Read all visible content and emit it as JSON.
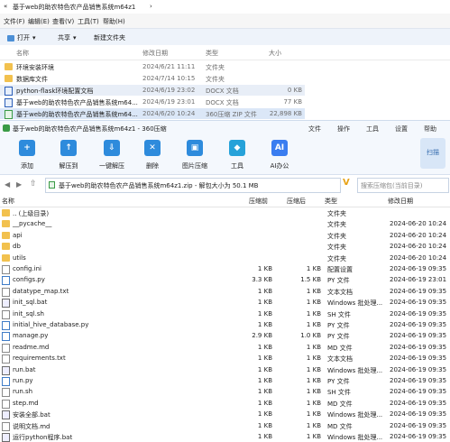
{
  "explorer": {
    "path": [
      "基于web的助农特色农产品销售系统m64z1"
    ],
    "menu": [
      "文件(F)",
      "编辑(E)",
      "查看(V)",
      "工具(T)",
      "帮助(H)"
    ],
    "toolbar": [
      "打开",
      "共享",
      "新建文件夹"
    ],
    "columns": {
      "name": "名称",
      "date": "修改日期",
      "type": "类型",
      "size": "大小"
    },
    "rows": [
      {
        "name": "环境安装环境",
        "date": "2024/6/21 11:11",
        "type": "文件夹",
        "size": "",
        "icon": "folder-icon"
      },
      {
        "name": "数据库文件",
        "date": "2024/7/14 10:15",
        "type": "文件夹",
        "size": "",
        "icon": "folder-icon"
      },
      {
        "name": "python-flask环境配置文档",
        "date": "2024/6/19 23:02",
        "type": "DOCX 文档",
        "size": "0 KB",
        "icon": "docx-icon"
      },
      {
        "name": "基于web的助农特色农产品销售系统m64...",
        "date": "2024/6/19 23:01",
        "type": "DOCX 文档",
        "size": "77 KB",
        "icon": "docx-icon"
      },
      {
        "name": "基于web的助农特色农产品销售系统m64...",
        "date": "2024/6/20 10:24",
        "type": "360压缩 ZIP 文件",
        "size": "22,898 KB",
        "icon": "zip-icon"
      }
    ]
  },
  "zip": {
    "title": "基于web的助农特色农产品销售系统m64z1 - 360压缩",
    "title_menu": [
      "文件",
      "操作",
      "工具",
      "设置",
      "帮助"
    ],
    "toolbar": [
      {
        "label": "添加",
        "icon": "add-icon",
        "color": "#2e8bdc"
      },
      {
        "label": "解压到",
        "icon": "extract-icon",
        "color": "#2e8bdc"
      },
      {
        "label": "一键解压",
        "icon": "one-click-extract-icon",
        "color": "#2e8bdc"
      },
      {
        "label": "删除",
        "icon": "delete-icon",
        "color": "#2e8bdc"
      },
      {
        "label": "图片压缩",
        "icon": "image-compress-icon",
        "color": "#2e8bdc"
      },
      {
        "label": "工具",
        "icon": "tools-icon",
        "color": "#26a2d9"
      },
      {
        "label": "AI办公",
        "icon": "ai-office-icon",
        "color": "#3a7df0"
      }
    ],
    "scan_label": "扫描",
    "address": "基于web的助农特色农产品销售系统m64z1.zip - 解包大小为 50.1 MB",
    "search_placeholder": "搜索压缩包(当前目录)",
    "columns": {
      "name": "名称",
      "size": "压缩前",
      "packed": "压缩后",
      "type": "类型",
      "date": "修改日期"
    },
    "rows": [
      {
        "name": ".. (上级目录)",
        "size": "",
        "packed": "",
        "type": "文件夹",
        "date": "",
        "icon": "folder"
      },
      {
        "name": "__pycache__",
        "size": "",
        "packed": "",
        "type": "文件夹",
        "date": "2024-06-20 10:24",
        "icon": "folder"
      },
      {
        "name": "api",
        "size": "",
        "packed": "",
        "type": "文件夹",
        "date": "2024-06-20 10:24",
        "icon": "folder"
      },
      {
        "name": "db",
        "size": "",
        "packed": "",
        "type": "文件夹",
        "date": "2024-06-20 10:24",
        "icon": "folder"
      },
      {
        "name": "utils",
        "size": "",
        "packed": "",
        "type": "文件夹",
        "date": "2024-06-20 10:24",
        "icon": "folder"
      },
      {
        "name": "config.ini",
        "size": "1 KB",
        "packed": "1 KB",
        "type": "配置设置",
        "date": "2024-06-19 09:35",
        "icon": "file"
      },
      {
        "name": "configs.py",
        "size": "3.3 KB",
        "packed": "1.5 KB",
        "type": "PY 文件",
        "date": "2024-06-19 23:01",
        "icon": "py"
      },
      {
        "name": "datatype_map.txt",
        "size": "1 KB",
        "packed": "1 KB",
        "type": "文本文档",
        "date": "2024-06-19 09:35",
        "icon": "file"
      },
      {
        "name": "init_sql.bat",
        "size": "1 KB",
        "packed": "1 KB",
        "type": "Windows 批处理...",
        "date": "2024-06-19 09:35",
        "icon": "bat"
      },
      {
        "name": "init_sql.sh",
        "size": "1 KB",
        "packed": "1 KB",
        "type": "SH 文件",
        "date": "2024-06-19 09:35",
        "icon": "file"
      },
      {
        "name": "initial_hive_database.py",
        "size": "1 KB",
        "packed": "1 KB",
        "type": "PY 文件",
        "date": "2024-06-19 09:35",
        "icon": "py"
      },
      {
        "name": "manage.py",
        "size": "2.9 KB",
        "packed": "1.0 KB",
        "type": "PY 文件",
        "date": "2024-06-19 09:35",
        "icon": "py"
      },
      {
        "name": "readme.md",
        "size": "1 KB",
        "packed": "1 KB",
        "type": "MD 文件",
        "date": "2024-06-19 09:35",
        "icon": "file"
      },
      {
        "name": "requirements.txt",
        "size": "1 KB",
        "packed": "1 KB",
        "type": "文本文档",
        "date": "2024-06-19 09:35",
        "icon": "file"
      },
      {
        "name": "run.bat",
        "size": "1 KB",
        "packed": "1 KB",
        "type": "Windows 批处理...",
        "date": "2024-06-19 09:35",
        "icon": "bat"
      },
      {
        "name": "run.py",
        "size": "1 KB",
        "packed": "1 KB",
        "type": "PY 文件",
        "date": "2024-06-19 09:35",
        "icon": "py"
      },
      {
        "name": "run.sh",
        "size": "1 KB",
        "packed": "1 KB",
        "type": "SH 文件",
        "date": "2024-06-19 09:35",
        "icon": "file"
      },
      {
        "name": "step.md",
        "size": "1 KB",
        "packed": "1 KB",
        "type": "MD 文件",
        "date": "2024-06-19 09:35",
        "icon": "file"
      },
      {
        "name": "安装全部.bat",
        "size": "1 KB",
        "packed": "1 KB",
        "type": "Windows 批处理...",
        "date": "2024-06-19 09:35",
        "icon": "bat"
      },
      {
        "name": "说明文档.md",
        "size": "1 KB",
        "packed": "1 KB",
        "type": "MD 文件",
        "date": "2024-06-19 09:35",
        "icon": "file"
      },
      {
        "name": "运行python程序.bat",
        "size": "1 KB",
        "packed": "1 KB",
        "type": "Windows 批处理...",
        "date": "2024-06-19 09:35",
        "icon": "bat"
      }
    ]
  }
}
